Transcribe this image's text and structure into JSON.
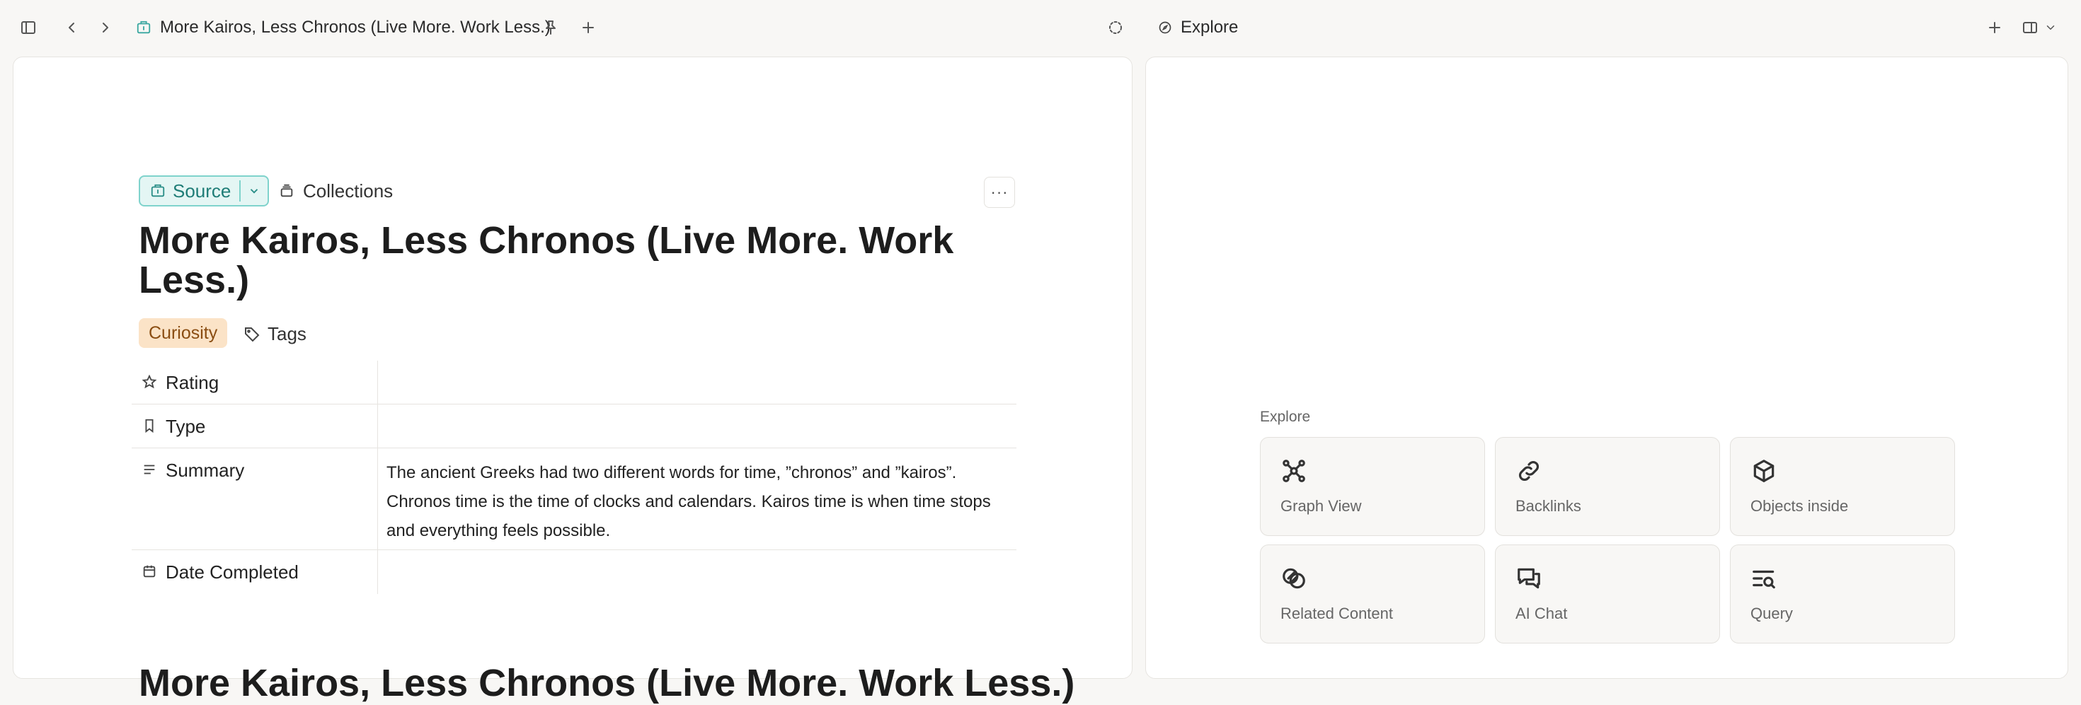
{
  "tab": {
    "title": "More Kairos, Less Chronos (Live More. Work Less.)"
  },
  "right_tab": {
    "title": "Explore"
  },
  "note": {
    "type_label": "Source",
    "collections_label": "Collections",
    "more_label": "···",
    "title": "More Kairos, Less Chronos (Live More. Work Less.)",
    "tag": "Curiosity",
    "tags_label": "Tags",
    "properties": [
      {
        "label": "Rating",
        "value": ""
      },
      {
        "label": "Type",
        "value": ""
      },
      {
        "label": "Summary",
        "value": "The ancient Greeks had two different words for time, ”chronos” and ”kairos”. Chronos time is the time of clocks and calendars. Kairos time is when time stops and everything feels possible."
      },
      {
        "label": "Date Completed",
        "value": ""
      }
    ],
    "next_heading": "More Kairos, Less Chronos (Live More. Work Less.)"
  },
  "explore": {
    "label": "Explore",
    "cards": [
      {
        "label": "Graph View",
        "icon": "graph-icon"
      },
      {
        "label": "Backlinks",
        "icon": "link-icon"
      },
      {
        "label": "Objects inside",
        "icon": "cube-icon"
      },
      {
        "label": "Related Content",
        "icon": "related-icon"
      },
      {
        "label": "AI Chat",
        "icon": "chat-icon"
      },
      {
        "label": "Query",
        "icon": "query-icon"
      }
    ]
  },
  "colors": {
    "accent_teal": "#3aa7a0",
    "tag_bg": "#fbe3c7",
    "tag_text": "#8a4d12",
    "source_bg": "#e4f6f4"
  }
}
